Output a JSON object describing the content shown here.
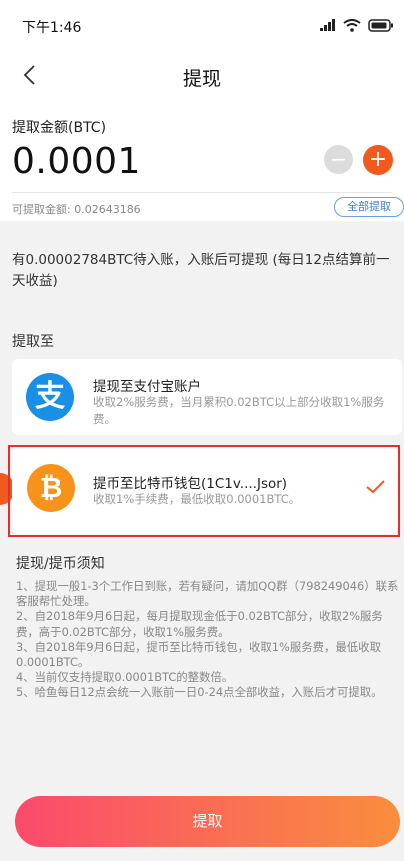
{
  "status_bar": {
    "time": "下午1:46"
  },
  "header": {
    "title": "提现"
  },
  "amount": {
    "label": "提取金额(BTC)",
    "value": "0.0001",
    "minus": "−",
    "plus": "+",
    "available": "可提取金额: 0.02643186",
    "withdraw_all": "全部提取"
  },
  "notice": "有0.00002784BTC待入账，入账后可提现 (每日12点结算前一天收益)",
  "withdraw_to": {
    "label": "提取至",
    "options": [
      {
        "title": "提现至支付宝账户",
        "desc": "收取2%服务费，当月累积0.02BTC以上部分收取1%服务费。",
        "icon": "支"
      },
      {
        "title": "提币至比特币钱包(1C1v....Jsor)",
        "desc": "收取1%手续费，最低收取0.0001BTC。",
        "icon": "₿",
        "selected": true
      }
    ]
  },
  "rules": {
    "title": "提现/提币须知",
    "items": [
      "1、提现一般1-3个工作日到账，若有疑问，请加QQ群（798249046）联系客服帮忙处理。",
      "2、自2018年9月6日起，每月提取现金低于0.02BTC部分，收取2%服务费，高于0.02BTC部分，收取1%服务费。",
      "3、自2018年9月6日起，提币至比特币钱包，收取1%服务费，最低收取0.0001BTC。",
      "4、当前仅支持提取0.0001BTC的整数倍。",
      "5、哈鱼每日12点会统一入账前一日0-24点全部收益，入账后才可提取。"
    ]
  },
  "submit_label": "提取",
  "colors": {
    "accent": "#f05a1e",
    "alipay": "#1a8fe6",
    "bitcoin": "#f7931a",
    "link": "#3a7fd5",
    "selection": "#e03030"
  }
}
